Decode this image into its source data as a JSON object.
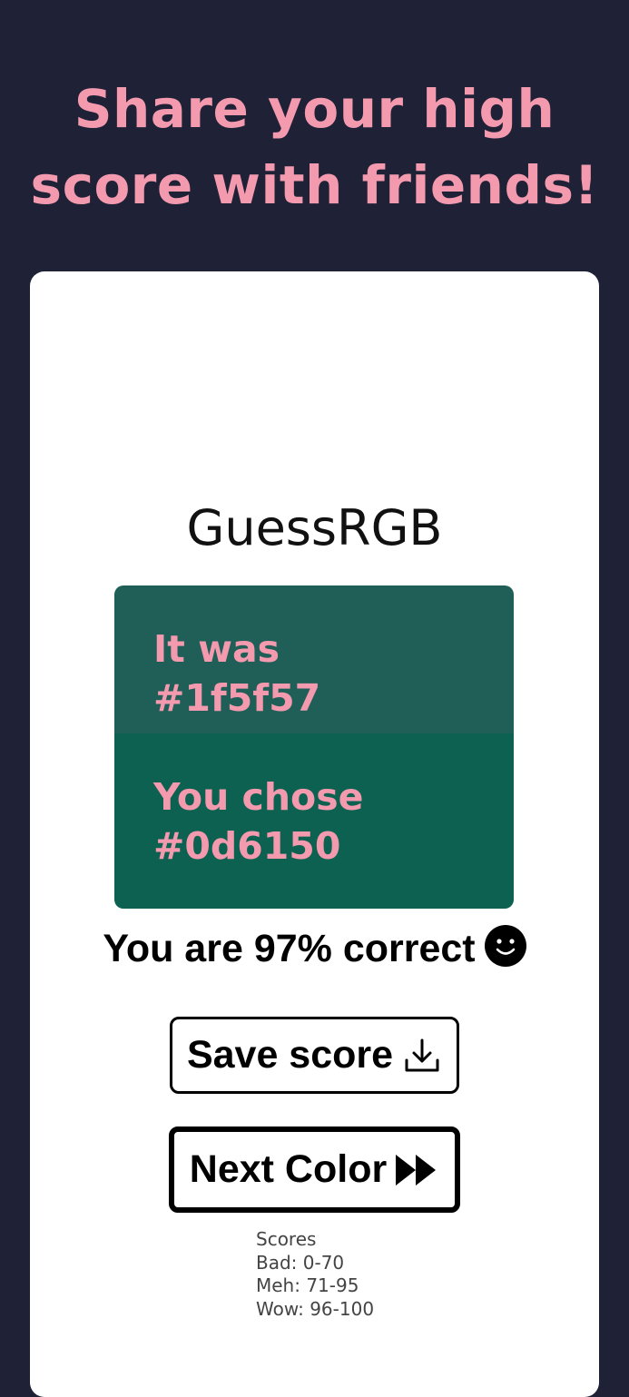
{
  "headline": {
    "line1": "Share your high",
    "line2": "score with friends!"
  },
  "app": {
    "title": "GuessRGB"
  },
  "swatch": {
    "actual_label": "It was",
    "actual_hex": "#1f5f57",
    "chosen_label": "You chose",
    "chosen_hex": "#0d6150"
  },
  "result": {
    "text": "You are 97% correct",
    "icon": "smile-face-icon",
    "percent": 97
  },
  "buttons": {
    "save_label": "Save score",
    "save_icon": "download-icon",
    "next_label": "Next Color",
    "next_icon": "fast-forward-icon"
  },
  "scores": {
    "heading": "Scores",
    "bad": "Bad: 0-70",
    "meh": "Meh: 71-95",
    "wow": "Wow: 96-100"
  },
  "colors": {
    "background": "#1f2136",
    "accent": "#f49aaf",
    "card": "#ffffff"
  }
}
